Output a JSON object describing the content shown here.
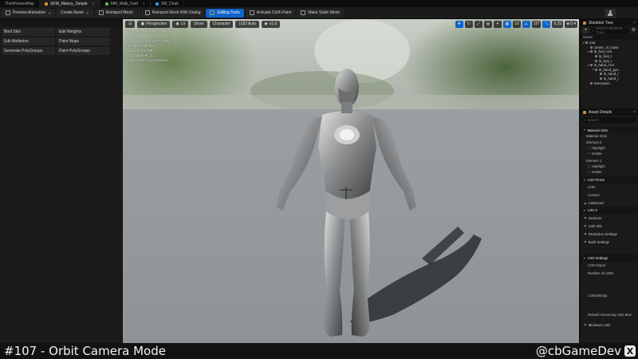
{
  "tabs": [
    {
      "label": "ThirdPersonMap",
      "icon": "level-icon",
      "active": false
    },
    {
      "label": "SKM_Manny_Simple",
      "icon": "skeletal-mesh-icon",
      "active": true
    },
    {
      "label": "MM_Walk_Fwd",
      "icon": "animation-icon",
      "active": false
    },
    {
      "label": "SM_Chair",
      "icon": "static-mesh-icon",
      "active": false
    }
  ],
  "toolbar": {
    "preview_animation": "Preview Animation",
    "create_asset": "Create Asset",
    "reimport_mesh": "Reimport Mesh",
    "reimport_mesh_dialog": "Reimport Mesh With Dialog",
    "editing_tools": "Editing Tools",
    "activate_cloth_paint": "Activate Cloth Paint",
    "make_static_mesh": "Make Static Mesh"
  },
  "tools": [
    {
      "label": "Bind Skin"
    },
    {
      "label": "Edit Weights"
    },
    {
      "label": "Edit Attributes"
    },
    {
      "label": "Paint Maps"
    },
    {
      "label": "Generate PolyGroups"
    },
    {
      "label": "Paint PolyGroups"
    }
  ],
  "viewport": {
    "perspective": "Perspective",
    "lit": "Lit",
    "show": "Show",
    "character": "Character",
    "lod_auto": "LOD Auto",
    "speed": "x1.0",
    "snap_angle": "10",
    "grid_snap": "10°",
    "scale_snap": "0.25",
    "camera_speed": "0.4",
    "stats": [
      "Previewing Reference Pose",
      "LOD: 0",
      "Current Screen Size: 0.95",
      "Triangles: 92,178",
      "Vertices: 46,799",
      "UV Channels: 1",
      "Approx Size: 117x46x181"
    ]
  },
  "skeleton_tree": {
    "title": "Skeleton Tree",
    "search_placeholder": "Search Skeleton Tree...",
    "column": "Name",
    "bones": [
      {
        "label": "root",
        "depth": 0
      },
      {
        "label": "center_of_mass",
        "depth": 1
      },
      {
        "label": "ik_foot_root",
        "depth": 1
      },
      {
        "label": "ik_foot_l",
        "depth": 2
      },
      {
        "label": "ik_foot_r",
        "depth": 2
      },
      {
        "label": "ik_hand_root",
        "depth": 1
      },
      {
        "label": "ik_hand_gun",
        "depth": 2
      },
      {
        "label": "ik_hand_l",
        "depth": 3
      },
      {
        "label": "ik_hand_r",
        "depth": 3
      },
      {
        "label": "interaction",
        "depth": 1
      }
    ]
  },
  "asset_details": {
    "title": "Asset Details",
    "search_placeholder": "Search",
    "material_slots": "Material Slots",
    "material_slots_sub": "Material Slots",
    "element_0": "Element 0",
    "element_1": "Element 1",
    "highlight": "Highlight",
    "isolate": "Isolate",
    "lod_picker": "LOD Picker",
    "lod": "LOD",
    "custom": "Custom",
    "advanced": "Advanced",
    "lod_0": "LOD 0",
    "sections": "Sections",
    "lod_info": "LOD Info",
    "reduction_settings": "Reduction Settings",
    "build_settings": "Build Settings",
    "lod_settings": "LOD Settings",
    "lod_import": "LOD Import",
    "number_of_lods": "Number of LODs",
    "lod_settings_field": "LODSettings",
    "rebuild_streaming": "Rebuild Streaming LOD Bias",
    "minimum_lod": "Minimum LOD"
  },
  "caption": {
    "title": "#107 - Orbit Camera Mode",
    "handle": "@cbGameDev",
    "x_logo": "X"
  }
}
